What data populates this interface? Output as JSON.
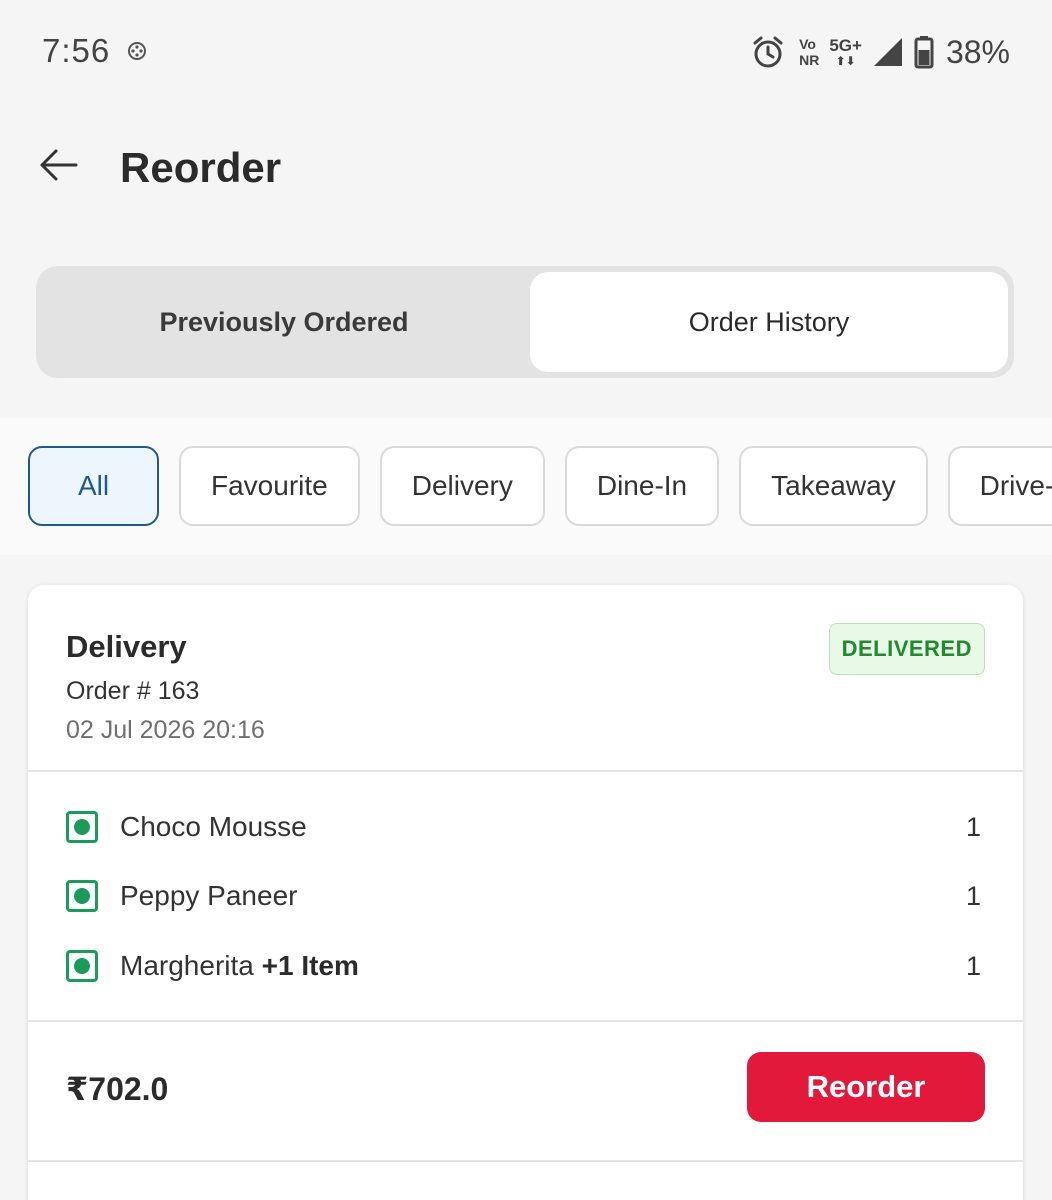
{
  "status_bar": {
    "time": "7:56",
    "network_vo": "Vo",
    "network_nr": "NR",
    "network_type": "5G+",
    "battery": "38%"
  },
  "header": {
    "title": "Reorder"
  },
  "tabs": {
    "previously_ordered": "Previously Ordered",
    "order_history": "Order History",
    "selected": "order_history"
  },
  "filters": [
    {
      "label": "All",
      "active": true
    },
    {
      "label": "Favourite",
      "active": false
    },
    {
      "label": "Delivery",
      "active": false
    },
    {
      "label": "Dine-In",
      "active": false
    },
    {
      "label": "Takeaway",
      "active": false
    },
    {
      "label": "Drive-",
      "active": false
    }
  ],
  "order": {
    "type": "Delivery",
    "number": "Order # 163",
    "date": "02 Jul 2026 20:16",
    "status": "DELIVERED",
    "items": [
      {
        "name": "Choco Mousse",
        "extra": "",
        "qty": "1"
      },
      {
        "name": "Peppy Paneer",
        "extra": "",
        "qty": "1"
      },
      {
        "name": "Margherita",
        "extra": "+1 Item",
        "qty": "1"
      }
    ],
    "total": "₹702.0",
    "reorder_label": "Reorder"
  },
  "colors": {
    "accent_red": "#e3193b",
    "veg_green": "#1a9b5a",
    "active_chip": "#1f5a8a",
    "status_green": "#1f8a2e"
  }
}
